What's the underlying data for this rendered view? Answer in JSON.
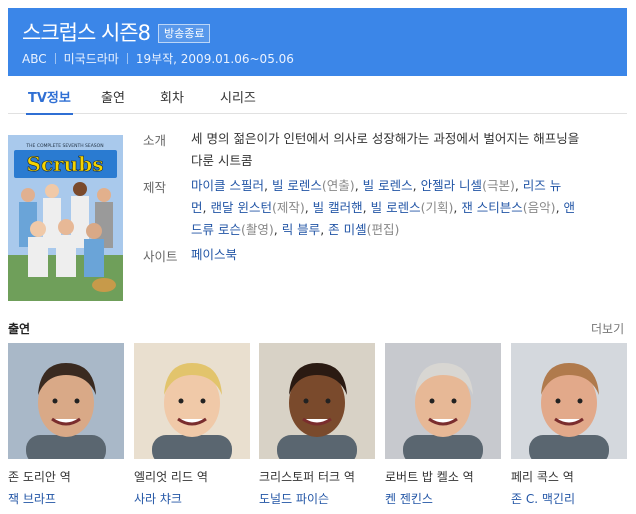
{
  "header": {
    "title": "스크럽스 시즌8",
    "badge": "방송종료",
    "channel": "ABC",
    "genre": "미국드라마",
    "episodes_dates": "19부작, 2009.01.06~05.06"
  },
  "tabs": [
    {
      "label": "TV정보",
      "active": true
    },
    {
      "label": "출연",
      "active": false
    },
    {
      "label": "회차",
      "active": false
    },
    {
      "label": "시리즈",
      "active": false
    }
  ],
  "poster": {
    "tagline": "THE COMPLETE SEVENTH SEASON",
    "logo": "Scrubs"
  },
  "info": {
    "synopsis_label": "소개",
    "synopsis_line1": "세 명의 젊은이가 인턴에서 의사로 성장해가는 과정에서 벌어지는 해프닝을",
    "synopsis_line2": "다룬 시트콤",
    "production_label": "제작",
    "production": {
      "line1": [
        {
          "name": "마이클 스필러",
          "role": ""
        },
        {
          "sep": ", "
        },
        {
          "name": "빌 로렌스",
          "role": "(연출)"
        },
        {
          "sep": ", "
        },
        {
          "name": "빌 로렌스",
          "role": ""
        },
        {
          "sep": ", "
        },
        {
          "name": "안젤라 니셀",
          "role": "(극본)"
        },
        {
          "sep": ", "
        },
        {
          "name": "리즈 뉴",
          "role": ""
        }
      ],
      "line2": [
        {
          "name": "먼",
          "role": ""
        },
        {
          "sep": ", "
        },
        {
          "name": "랜달 윈스턴",
          "role": "(제작)"
        },
        {
          "sep": ", "
        },
        {
          "name": "빌 캘러핸",
          "role": ""
        },
        {
          "sep": ", "
        },
        {
          "name": "빌 로렌스",
          "role": "(기획)"
        },
        {
          "sep": ", "
        },
        {
          "name": "잰 스티븐스",
          "role": "(음악)"
        },
        {
          "sep": ", "
        },
        {
          "name": "앤",
          "role": ""
        }
      ],
      "line3": [
        {
          "name": "드류 로슨",
          "role": "(촬영)"
        },
        {
          "sep": ", "
        },
        {
          "name": "릭 블루",
          "role": ""
        },
        {
          "sep": ", "
        },
        {
          "name": "존 미셸",
          "role": "(편집)"
        }
      ]
    },
    "site_label": "사이트",
    "site_value": "페이스북"
  },
  "cast": {
    "heading": "출연",
    "more_label": "더보기",
    "members": [
      {
        "role": "존 도리안 역",
        "actor": "잭 브라프",
        "photo_bg": "#a9b8c8",
        "skin": "#d9a987",
        "hair": "#3a2a20"
      },
      {
        "role": "엘리엇 리드 역",
        "actor": "사라 챠크",
        "photo_bg": "#e9dfcf",
        "skin": "#f0c9a8",
        "hair": "#e2c46c"
      },
      {
        "role": "크리스토퍼 터크 역",
        "actor": "도널드 파이슨",
        "photo_bg": "#d8d2c6",
        "skin": "#7a4a2c",
        "hair": "#2a1a12"
      },
      {
        "role": "로버트 밥 켈소 역",
        "actor": "켄 젠킨스",
        "photo_bg": "#c7c9ce",
        "skin": "#e7b896",
        "hair": "#d8d6d2"
      },
      {
        "role": "페리 콕스 역",
        "actor": "존 C. 맥긴리",
        "photo_bg": "#d4d8dd",
        "skin": "#e2a98a",
        "hair": "#b07a4c"
      }
    ]
  }
}
